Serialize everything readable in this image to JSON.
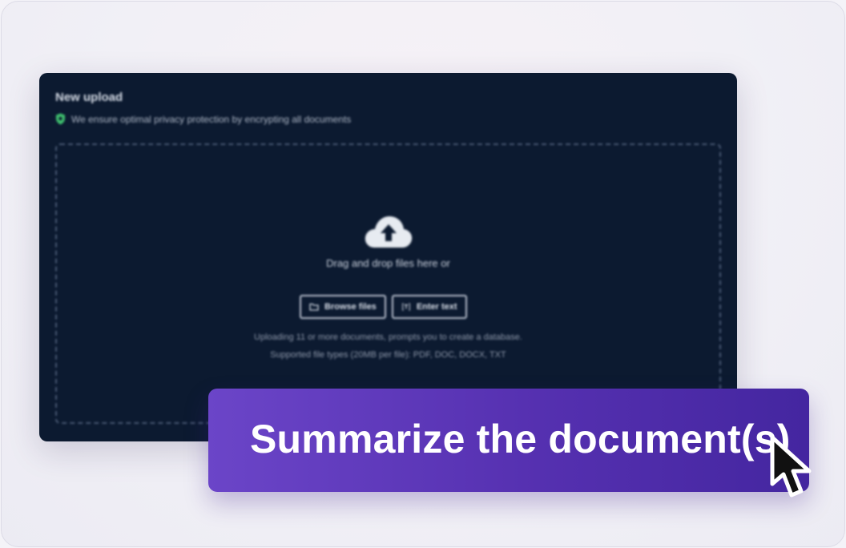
{
  "upload_panel": {
    "title": "New upload",
    "privacy_note": "We ensure optimal privacy protection by encrypting all documents",
    "dropzone_text": "Drag and drop files here or",
    "browse_button": "Browse files",
    "enter_text_button": "Enter text",
    "hint_line_1": "Uploading 11 or more documents, prompts you to create a database.",
    "hint_line_2": "Supported file types (20MB per file): PDF, DOC, DOCX, TXT"
  },
  "action_banner": {
    "label": "Summarize the document(s)"
  },
  "icons": {
    "privacy": "shield-icon",
    "upload": "cloud-upload-icon",
    "browse": "folder-icon",
    "enter_text": "text-cursor-icon",
    "pointer": "mouse-pointer-icon"
  },
  "colors": {
    "panel_bg": "#0c1a30",
    "accent_green": "#3fbf6e",
    "banner_start": "#6b45c8",
    "banner_end": "#4426a0"
  }
}
